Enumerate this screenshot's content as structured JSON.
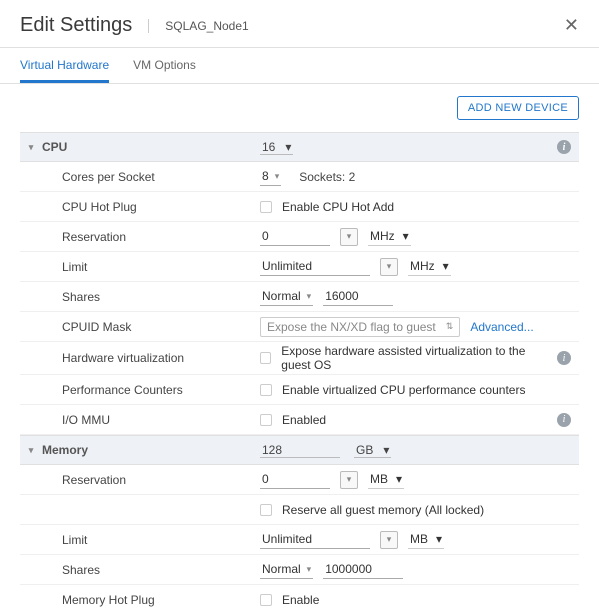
{
  "header": {
    "title": "Edit Settings",
    "subtitle": "SQLAG_Node1"
  },
  "tabs": {
    "hw": "Virtual Hardware",
    "vmopts": "VM Options"
  },
  "toolbar": {
    "add_device": "ADD NEW DEVICE"
  },
  "cpu": {
    "label": "CPU",
    "value": "16",
    "cores_label": "Cores per Socket",
    "cores_value": "8",
    "sockets_label": "Sockets: 2",
    "hotplug_label": "CPU Hot Plug",
    "hotplug_check": "Enable CPU Hot Add",
    "reservation_label": "Reservation",
    "reservation_value": "0",
    "reservation_unit": "MHz",
    "limit_label": "Limit",
    "limit_value": "Unlimited",
    "limit_unit": "MHz",
    "shares_label": "Shares",
    "shares_mode": "Normal",
    "shares_value": "16000",
    "cpuid_label": "CPUID Mask",
    "cpuid_value": "Expose the NX/XD flag to guest",
    "cpuid_adv": "Advanced...",
    "hwv_label": "Hardware virtualization",
    "hwv_check": "Expose hardware assisted virtualization to the guest OS",
    "perf_label": "Performance Counters",
    "perf_check": "Enable virtualized CPU performance counters",
    "iommu_label": "I/O MMU",
    "iommu_check": "Enabled"
  },
  "memory": {
    "label": "Memory",
    "value": "128",
    "unit": "GB",
    "reservation_label": "Reservation",
    "reservation_value": "0",
    "reservation_unit": "MB",
    "reserve_all_label": "Reserve all guest memory (All locked)",
    "limit_label": "Limit",
    "limit_value": "Unlimited",
    "limit_unit": "MB",
    "shares_label": "Shares",
    "shares_mode": "Normal",
    "shares_value": "1000000",
    "hotplug_label": "Memory Hot Plug",
    "hotplug_check": "Enable"
  }
}
